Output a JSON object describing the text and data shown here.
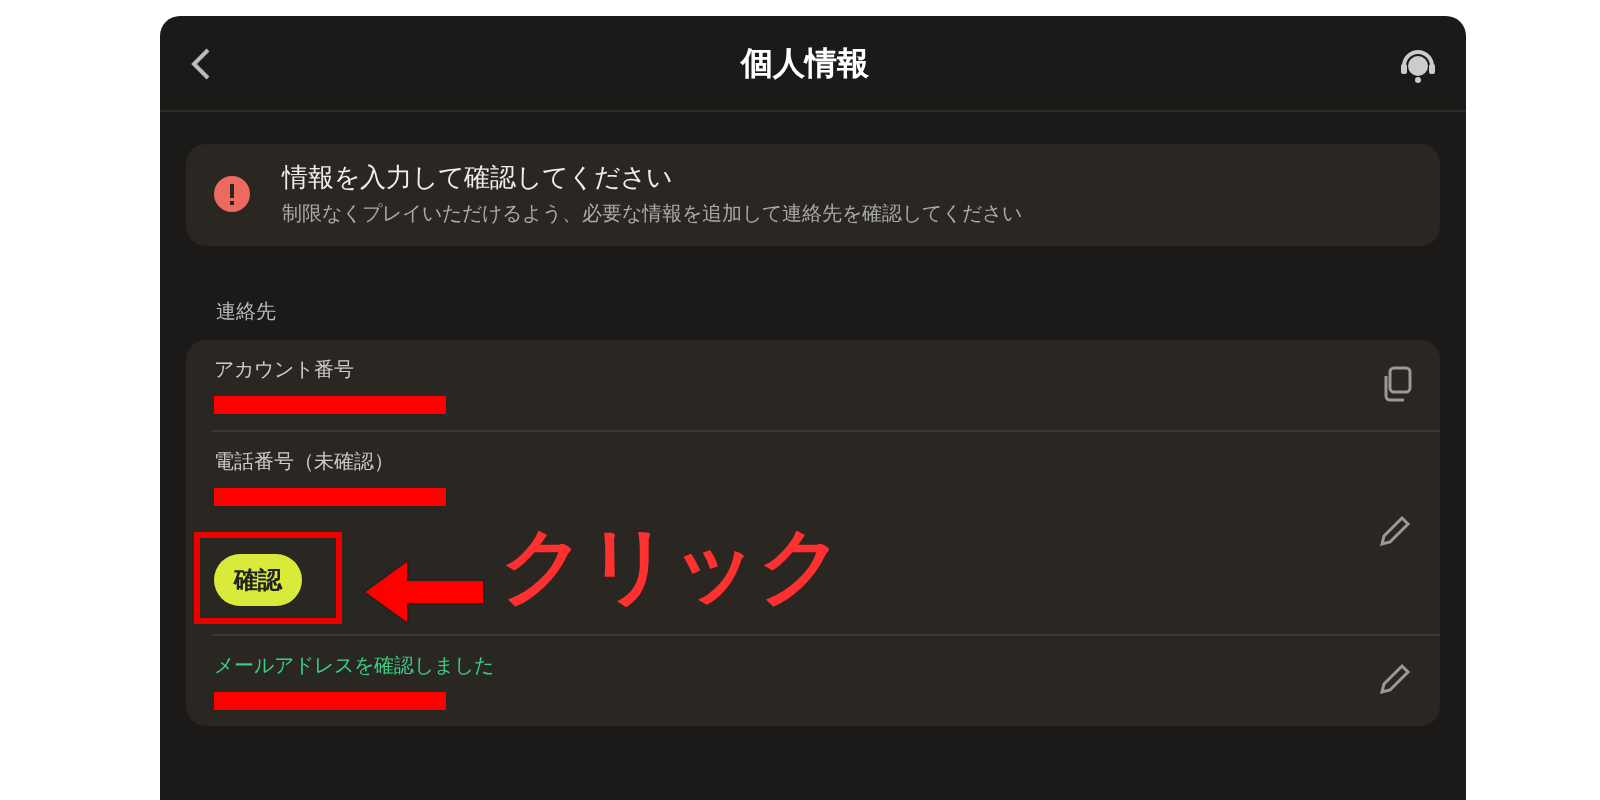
{
  "header": {
    "title": "個人情報"
  },
  "alert": {
    "title": "情報を入力して確認してください",
    "message": "制限なくプレイいただけるよう、必要な情報を追加して連絡先を確認してください"
  },
  "section": {
    "label": "連絡先"
  },
  "fields": [
    {
      "kind": "copy",
      "label": "アカウント番号",
      "verified": false,
      "redacted": true
    },
    {
      "kind": "edit",
      "label": "電話番号（未確認）",
      "verified": false,
      "redacted": true,
      "button": "確認"
    },
    {
      "kind": "edit",
      "label": "メールアドレスを確認しました",
      "verified": true,
      "redacted": true
    }
  ],
  "annotation": {
    "text": "クリック"
  }
}
